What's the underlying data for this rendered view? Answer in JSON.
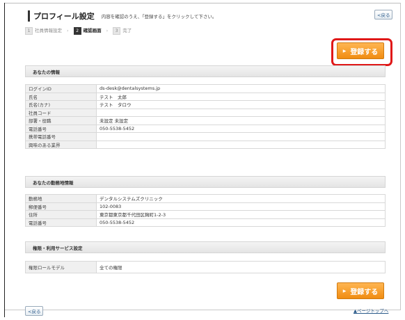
{
  "header": {
    "title": "プロフィール設定",
    "note": "内容を確認のうえ、「登録する」をクリックして下さい。",
    "back_label": "<戻る"
  },
  "steps": [
    {
      "num": "1",
      "label": "社員情報設定"
    },
    {
      "num": "2",
      "label": "確認画面"
    },
    {
      "num": "3",
      "label": "完了"
    }
  ],
  "register_label": "登録する",
  "sections": {
    "user": {
      "title": "あなたの情報",
      "rows": [
        {
          "label": "ログインID",
          "value": "ds-desk@dentalsystems.jp"
        },
        {
          "label": "氏名",
          "value": "テスト　太郎"
        },
        {
          "label": "氏名(カナ)",
          "value": "テスト　タロウ"
        },
        {
          "label": "社員コード",
          "value": ""
        },
        {
          "label": "部署・役職",
          "value": "未設定 未設定"
        },
        {
          "label": "電話番号",
          "value": "050-5538-5452"
        },
        {
          "label": "携帯電話番号",
          "value": ""
        },
        {
          "label": "興味のある業界",
          "value": ""
        }
      ]
    },
    "workplace": {
      "title": "あなたの勤務地情報",
      "rows": [
        {
          "label": "勤務地",
          "value": "デンタルシステムズクリニック"
        },
        {
          "label": "郵便番号",
          "value": "102-0083"
        },
        {
          "label": "住所",
          "value": "東京都東京都千代田区麹町1-2-3"
        },
        {
          "label": "電話番号",
          "value": "050-5538-5452"
        }
      ]
    },
    "permissions": {
      "title": "権限・利用サービス設定",
      "rows": [
        {
          "label": "権限ロールモデル",
          "value": "全ての権限"
        }
      ]
    }
  },
  "footer": {
    "back_label": "<戻る",
    "pagetop_label": "▲ページトップへ"
  }
}
